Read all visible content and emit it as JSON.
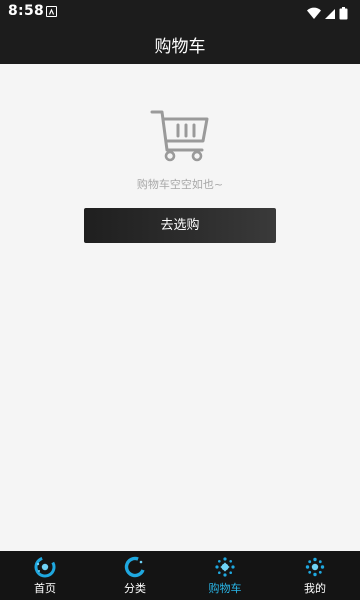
{
  "status_bar": {
    "time": "8:58",
    "notification_icon": "a-notification-icon",
    "wifi_icon": "wifi-icon",
    "signal_icon": "signal-icon",
    "battery_icon": "battery-icon"
  },
  "app_bar": {
    "title": "购物车"
  },
  "empty_state": {
    "icon": "shopping-cart-icon",
    "message": "购物车空空如也~",
    "button_label": "去选购"
  },
  "tab_bar": {
    "accent_color": "#29b6e8",
    "items": [
      {
        "label": "首页",
        "icon": "home-icon",
        "active": false
      },
      {
        "label": "分类",
        "icon": "category-icon",
        "active": false
      },
      {
        "label": "购物车",
        "icon": "cart-icon",
        "active": true
      },
      {
        "label": "我的",
        "icon": "profile-icon",
        "active": false
      }
    ]
  }
}
